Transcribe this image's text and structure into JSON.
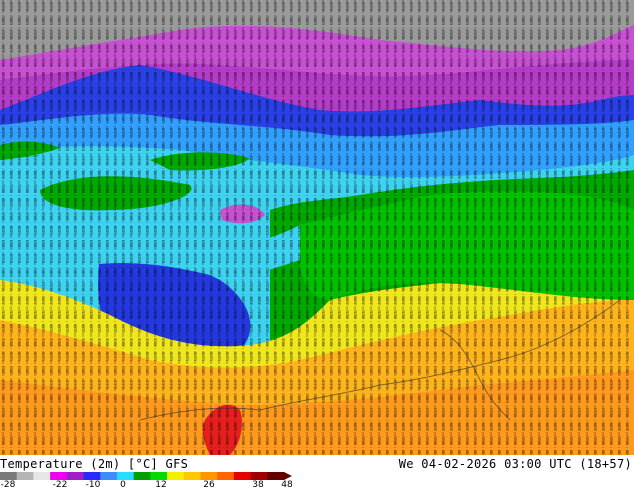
{
  "map": {
    "title": "Temperature (2m) [°C] GFS",
    "valid_time": "We 04-02-2026 03:00 UTC (18+57)"
  },
  "legend": {
    "ticks": [
      "-28",
      "-22",
      "-10",
      "0",
      "12",
      "26",
      "38",
      "48"
    ],
    "colors": [
      "#7a7a7a",
      "#b4b4b4",
      "#e6e6e6",
      "#f000f0",
      "#a020c8",
      "#2828ff",
      "#3c8cff",
      "#28dcff",
      "#00a000",
      "#00dc00",
      "#f0f000",
      "#ffc800",
      "#ff9600",
      "#ff6400",
      "#e60000",
      "#a00000",
      "#640000"
    ]
  },
  "colors": {
    "grey_cold": "#8c8c8c",
    "purple": "#b43cc8",
    "magenta": "#e650e6",
    "blue": "#1e3cdc",
    "light_blue": "#32a0ff",
    "cyan": "#3cd2f0",
    "green": "#00b400",
    "bright_green": "#00d200",
    "yellow": "#f0e61e",
    "orange": "#ffb41e",
    "red": "#e61e1e"
  }
}
